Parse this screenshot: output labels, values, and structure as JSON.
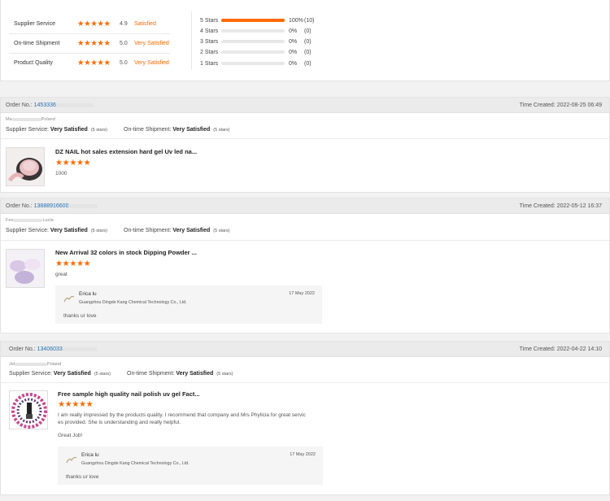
{
  "summary": {
    "rows": [
      {
        "label": "Supplier Service",
        "stars": "★★★★★",
        "score": "4.9",
        "sat": "Satisfied"
      },
      {
        "label": "On-time Shipment",
        "stars": "★★★★★",
        "score": "5.0",
        "sat": "Very Satisfied"
      },
      {
        "label": "Product Quality",
        "stars": "★★★★★",
        "score": "5.0",
        "sat": "Very Satisfied"
      }
    ],
    "distribution": [
      {
        "label": "5 Stars",
        "pct": "100%",
        "count": "(10)",
        "fill": 1.0
      },
      {
        "label": "4 Stars",
        "pct": "0%",
        "count": "(0)",
        "fill": 0
      },
      {
        "label": "3 Stars",
        "pct": "0%",
        "count": "(0)",
        "fill": 0
      },
      {
        "label": "2 Stars",
        "pct": "0%",
        "count": "(0)",
        "fill": 0
      },
      {
        "label": "1 Stars",
        "pct": "0%",
        "count": "(0)",
        "fill": 0
      }
    ]
  },
  "labels": {
    "order_no": "Order No.:",
    "time_created": "Time Created:",
    "supplier_service": "Supplier Service:",
    "ontime_shipment": "On-time Shipment:",
    "very_satisfied": "Very Satisfied",
    "five_stars": "(5 stars)"
  },
  "reviews": [
    {
      "order_no": "1453336",
      "time": "2022-08-25 06:49",
      "buyer_name": "Ma",
      "buyer_country": "Poland",
      "product_title": "DZ NAIL hot sales extension hard gel Uv led na...",
      "stars": "★★★★★",
      "comment": "1000"
    },
    {
      "order_no": "13888916600",
      "time": "2022-05-12 16:37",
      "buyer_name": "Fen",
      "buyer_country": "Lucia",
      "product_title": "New Arrival 32 colors in stock Dipping Powder ...",
      "stars": "★★★★★",
      "comment": "great",
      "reply": {
        "name": "Erica lu",
        "company": "Guangzhou Dingde Kang Chemical Technology Co., Ltd.",
        "date": "17 May 2022",
        "text": "thanks ur love"
      }
    },
    {
      "order_no": "13406033",
      "time": "2022-04-22 14:10",
      "buyer_name": "Jel",
      "buyer_country": "Poland",
      "product_title": "Free sample high quality nail polish uv gel Fact...",
      "stars": "★★★★★",
      "comment_line1": "I am really impressed by the products quality. I recommend that company and Mrs Phylicia for great servic",
      "comment_line2": "es provided. She is understanding and really helpful.",
      "comment_extra": "Great Job!",
      "reply": {
        "name": "Erica lu",
        "company": "Guangzhou Dingde Kang Chemical Technology Co., Ltd.",
        "date": "17 May 2022",
        "text": "thanks ur love"
      }
    }
  ],
  "colors": {
    "accent": "#ff6a00",
    "link": "#1f6fb8"
  }
}
